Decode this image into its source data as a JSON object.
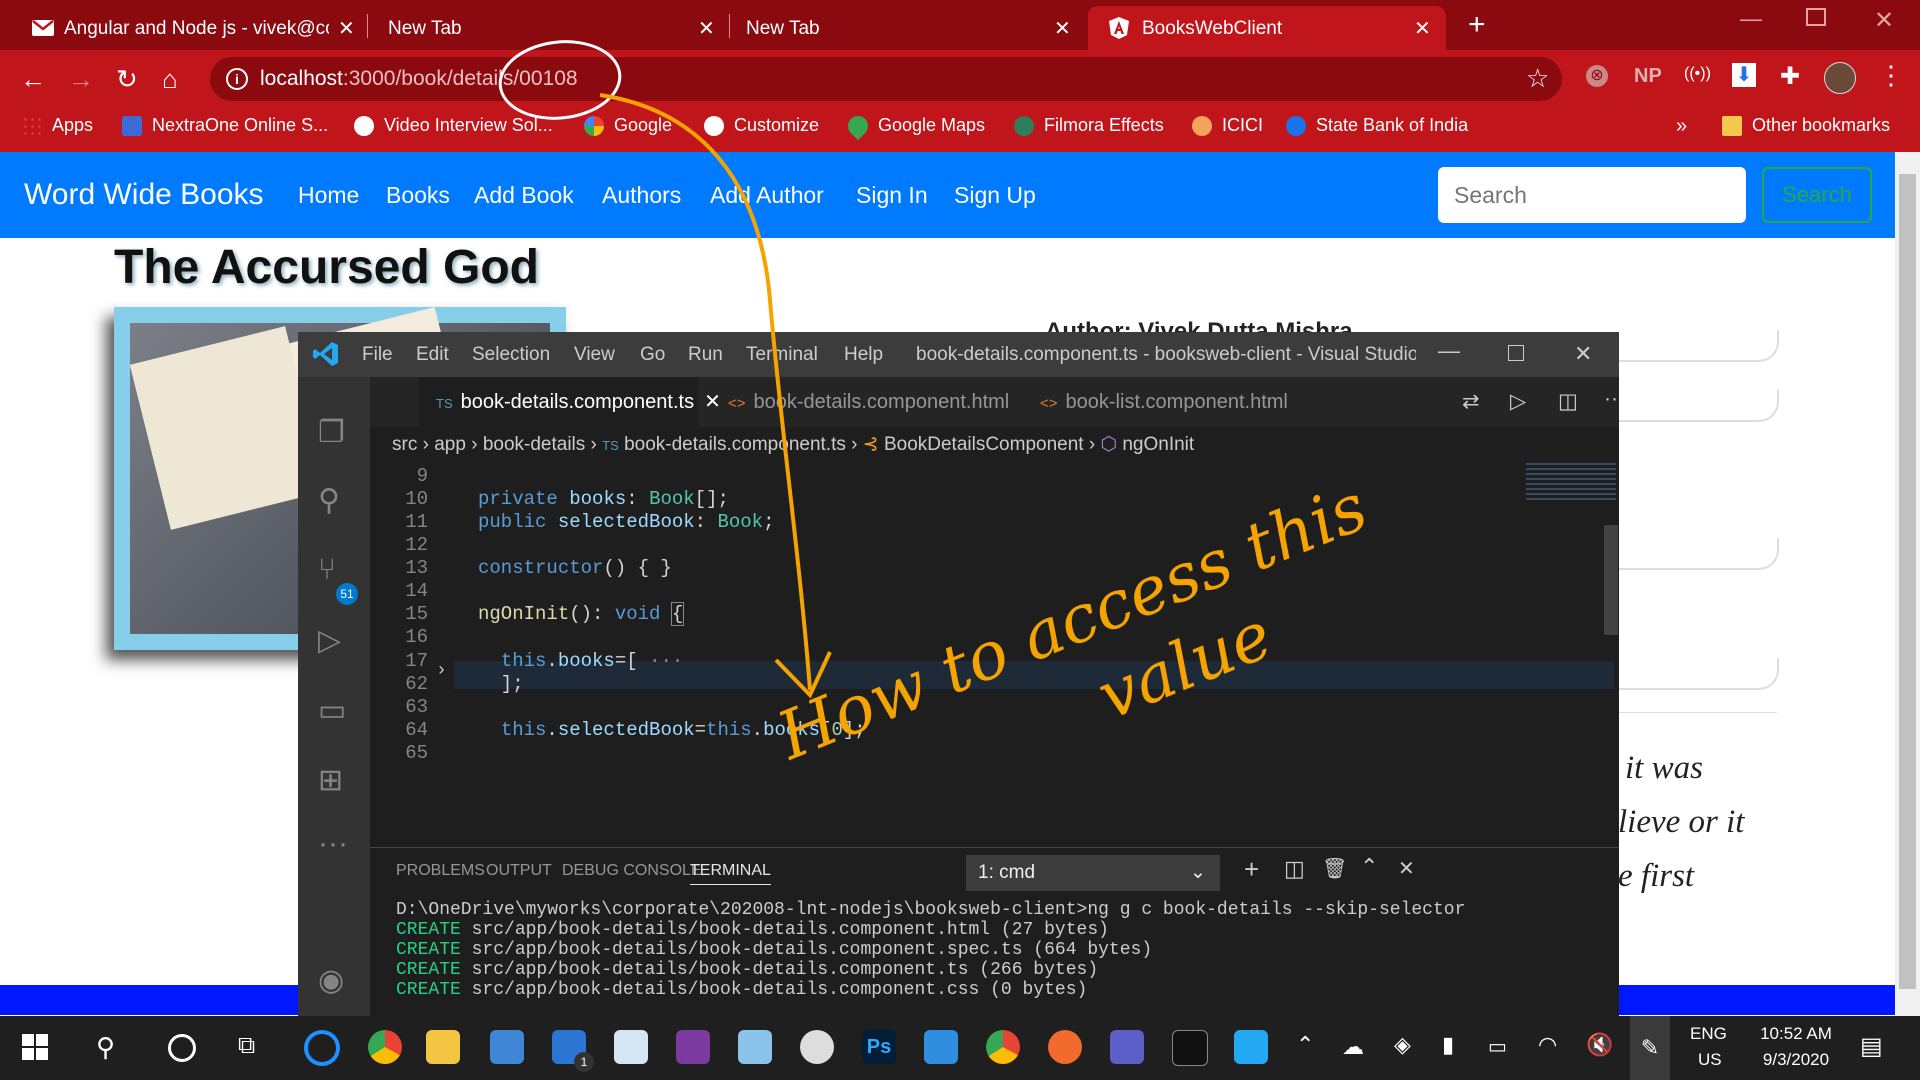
{
  "browser": {
    "tabs": [
      {
        "title": "Angular and Node js - vivek@cor"
      },
      {
        "title": "New Tab"
      },
      {
        "title": "New Tab"
      },
      {
        "title": "BooksWebClient"
      }
    ],
    "new_tab_glyph": "+",
    "url_host": "localhost",
    "url_path": ":3000/book/details/00108",
    "extension_np": "NP",
    "bookmarks": [
      {
        "label": "Apps",
        "icon": "apps-grid-icon"
      },
      {
        "label": "NextraOne Online S...",
        "icon": "nextraone-icon"
      },
      {
        "label": "Video Interview Sol...",
        "icon": "globe-icon"
      },
      {
        "label": "Google",
        "icon": "google-icon"
      },
      {
        "label": "Customize",
        "icon": "globe-icon"
      },
      {
        "label": "Google Maps",
        "icon": "maps-pin-icon"
      },
      {
        "label": "Filmora Effects",
        "icon": "filmora-icon"
      },
      {
        "label": "ICICI",
        "icon": "icici-icon"
      },
      {
        "label": "State Bank of India",
        "icon": "sbi-icon"
      }
    ],
    "bookmarks_overflow": "»",
    "other_bookmarks": "Other bookmarks"
  },
  "site": {
    "brand": "Word Wide Books",
    "nav": [
      "Home",
      "Books",
      "Add Book",
      "Authors",
      "Add Author",
      "Sign In",
      "Sign Up"
    ],
    "search_placeholder": "Search",
    "search_button": "Search",
    "book_title": "The Accursed God",
    "author_line": "Author: Vivek Dutta Mishra",
    "description_fragments": [
      "it was",
      "lieve or it",
      "e first"
    ]
  },
  "vscode": {
    "menu": [
      "File",
      "Edit",
      "Selection",
      "View",
      "Go",
      "Run",
      "Terminal",
      "Help"
    ],
    "window_title": "book-details.component.ts - booksweb-client - Visual Studio...",
    "tabs": [
      {
        "label": "book-details.component.ts",
        "lang": "TS"
      },
      {
        "label": "book-details.component.html",
        "lang": "<>"
      },
      {
        "label": "book-list.component.html",
        "lang": "<>"
      }
    ],
    "breadcrumb": [
      "src",
      "app",
      "book-details",
      "book-details.component.ts",
      "BookDetailsComponent",
      "ngOnInit"
    ],
    "breadcrumb_ts_tag": "TS",
    "source_control_badge": "51",
    "code_lines": [
      {
        "n": "9",
        "text": ""
      },
      {
        "n": "10",
        "text": "private books: Book[];"
      },
      {
        "n": "11",
        "text": "public selectedBook: Book;"
      },
      {
        "n": "12",
        "text": ""
      },
      {
        "n": "13",
        "text": "constructor() { }"
      },
      {
        "n": "14",
        "text": ""
      },
      {
        "n": "15",
        "text": "ngOnInit(): void {"
      },
      {
        "n": "16",
        "text": ""
      },
      {
        "n": "17",
        "text": "  this.books=[ ···"
      },
      {
        "n": "62",
        "text": "  ];"
      },
      {
        "n": "63",
        "text": ""
      },
      {
        "n": "64",
        "text": "  this.selectedBook=this.books[0];"
      },
      {
        "n": "65",
        "text": ""
      }
    ],
    "panel_tabs": [
      "PROBLEMS",
      "OUTPUT",
      "DEBUG CONSOLE",
      "TERMINAL"
    ],
    "terminal_select": "1: cmd",
    "terminal_lines": [
      {
        "prefix": "",
        "text": "D:\\OneDrive\\myworks\\corporate\\202008-lnt-nodejs\\booksweb-client>ng g c book-details --skip-selector"
      },
      {
        "prefix": "CREATE",
        "text": " src/app/book-details/book-details.component.html (27 bytes)"
      },
      {
        "prefix": "CREATE",
        "text": " src/app/book-details/book-details.component.spec.ts (664 bytes)"
      },
      {
        "prefix": "CREATE",
        "text": " src/app/book-details/book-details.component.ts (266 bytes)"
      },
      {
        "prefix": "CREATE",
        "text": " src/app/book-details/book-details.component.css (0 bytes)"
      }
    ]
  },
  "annotation": {
    "text_line1": "How to access this",
    "text_line2": "value",
    "ink_color": "#f5a300"
  },
  "taskbar": {
    "lang_top": "ENG",
    "lang_bottom": "US",
    "time": "10:52 AM",
    "date": "9/3/2020",
    "mail_badge": "1"
  }
}
